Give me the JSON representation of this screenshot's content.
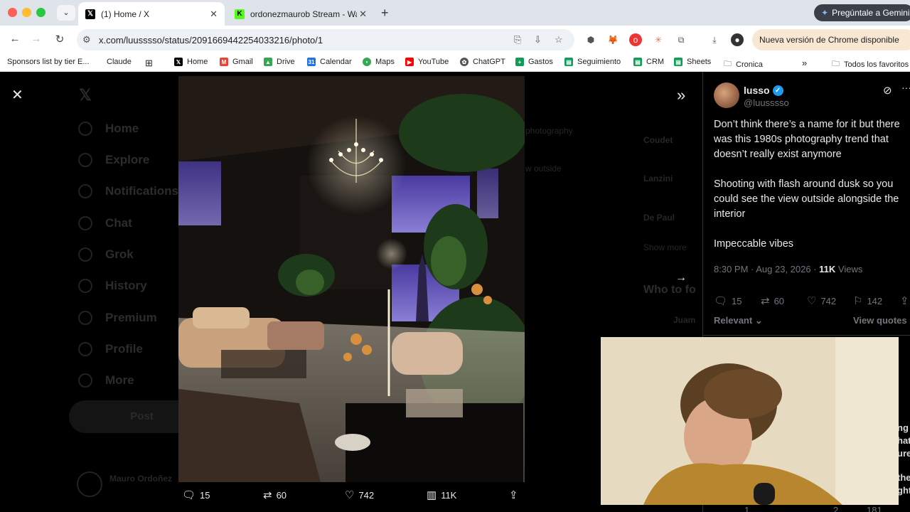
{
  "browser": {
    "tabs": [
      {
        "title": "(1) Home / X",
        "active": true
      },
      {
        "title": "ordonezmaurob Stream - Wat",
        "active": false
      }
    ],
    "gemini_button": "Pregúntale a Gemini",
    "url": "x.com/luusssso/status/2091669442254033216/photo/1",
    "update_button": "Nueva versión de Chrome disponible",
    "bookmarks": [
      "Sponsors list by tier E...",
      "Claude",
      "Home",
      "Gmail",
      "Drive",
      "Calendar",
      "Maps",
      "YouTube",
      "ChatGPT",
      "Gastos",
      "Seguimiento",
      "CRM",
      "Sheets",
      "Cronica"
    ],
    "bookmarks_overflow": "»",
    "all_bookmarks": "Todos los favoritos"
  },
  "background_nav": {
    "items": [
      "Home",
      "Explore",
      "Notifications",
      "Chat",
      "Grok",
      "History",
      "Premium",
      "Profile",
      "More"
    ],
    "post_button": "Post",
    "profile_name": "Mauro Ordoñez",
    "right_fragments": [
      "photography",
      "w outside",
      "Coudet",
      "Lanzini",
      "De Paul",
      "Show more",
      "Who to fo",
      "Juam"
    ]
  },
  "media_actions": {
    "replies": "15",
    "reposts": "60",
    "likes": "742",
    "views": "11K"
  },
  "tweet": {
    "display_name": "lusso",
    "handle": "@luusssso",
    "text": "Don’t think there’s a name for it but there was this 1980s photography trend that doesn’t really exist anymore\n\nShooting with flash around dusk so you could see the view outside alongside the interior\n\nImpeccable vibes",
    "time": "8:30 PM · Aug 23, 2026 · ",
    "views_count": "11K",
    "views_label": " Views",
    "replies": "15",
    "reposts": "60",
    "likes": "742",
    "bookmarks": "142",
    "sort_label": "Relevant",
    "view_quotes": "View quotes",
    "reply_fragments": [
      "ng",
      "hat",
      "ure",
      "the",
      "ght."
    ],
    "next_reply_counts": [
      "1",
      "2",
      "181"
    ]
  },
  "colors": {
    "accent": "#1d9bf0",
    "text_primary": "#e7e9ea",
    "text_secondary": "#71767b"
  }
}
